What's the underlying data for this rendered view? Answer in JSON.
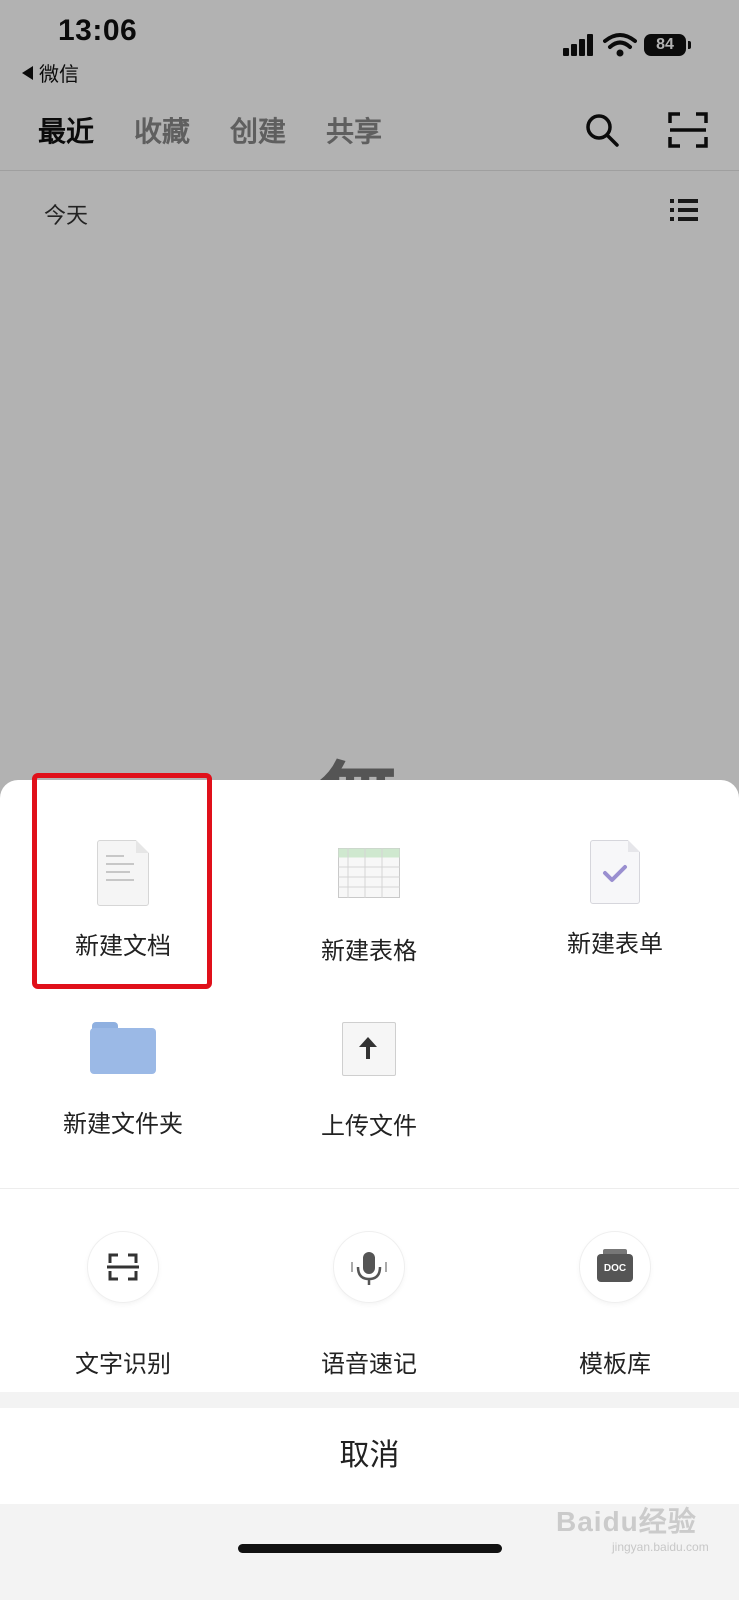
{
  "status_bar": {
    "time": "13:06",
    "back_app": "微信",
    "battery": "84"
  },
  "header": {
    "tabs": [
      {
        "label": "最近",
        "active": true
      },
      {
        "label": "收藏",
        "active": false
      },
      {
        "label": "创建",
        "active": false
      },
      {
        "label": "共享",
        "active": false
      }
    ]
  },
  "list": {
    "section_label": "今天",
    "empty_glyph": "無"
  },
  "sheet": {
    "create_items": [
      {
        "label": "新建文档",
        "icon": "doc-icon"
      },
      {
        "label": "新建表格",
        "icon": "spreadsheet-icon"
      },
      {
        "label": "新建表单",
        "icon": "form-icon"
      },
      {
        "label": "新建文件夹",
        "icon": "folder-icon"
      },
      {
        "label": "上传文件",
        "icon": "upload-icon"
      }
    ],
    "tool_items": [
      {
        "label": "文字识别",
        "icon": "ocr-scan-icon"
      },
      {
        "label": "语音速记",
        "icon": "microphone-icon"
      },
      {
        "label": "模板库",
        "icon": "doc-template-icon",
        "badge": "DOC"
      }
    ],
    "cancel_label": "取消"
  },
  "watermark": {
    "text": "Baidu经验",
    "sub": "jingyan.baidu.com"
  },
  "colors": {
    "highlight": "#e0101a",
    "folder": "#9bb9e6",
    "overlay": "rgba(0,0,0,0.30)"
  }
}
